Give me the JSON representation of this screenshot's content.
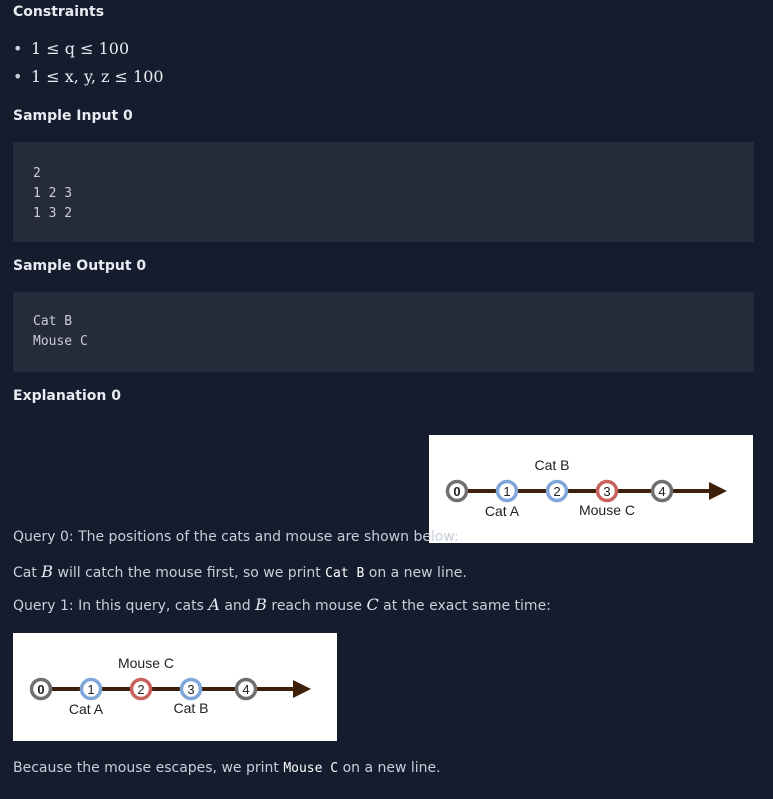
{
  "constraints": {
    "heading": "Constraints",
    "items": [
      "1 ≤ q ≤ 100",
      "1 ≤ x, y, z ≤ 100"
    ]
  },
  "sample_input": {
    "heading": "Sample Input 0",
    "lines": [
      "2",
      "1 2 3",
      "1 3 2"
    ]
  },
  "sample_output": {
    "heading": "Sample Output 0",
    "lines": [
      "Cat B",
      "Mouse C"
    ]
  },
  "explanation": {
    "heading": "Explanation 0",
    "query0": "Query 0: The positions of the cats and mouse are shown below:",
    "line2_pre": "Cat ",
    "line2_var": "B",
    "line2_mid": " will catch the mouse first, so we print ",
    "line2_code": "Cat B",
    "line2_post": " on a new line.",
    "query1_pre": "Query 1: In this query, cats ",
    "query1_a": "A",
    "query1_and": " and ",
    "query1_b": "B",
    "query1_mid": " reach mouse ",
    "query1_c": "C",
    "query1_post": " at the exact same time:",
    "final_pre": "Because the mouse escapes, we print ",
    "final_code": "Mouse C",
    "final_post": " on a new line."
  },
  "figure1": {
    "nodes": [
      "0",
      "1",
      "2",
      "3",
      "4"
    ],
    "label_above": "Cat B",
    "label_below_1": "Cat A",
    "label_below_3": "Mouse C"
  },
  "figure2": {
    "nodes": [
      "0",
      "1",
      "2",
      "3",
      "4"
    ],
    "label_above": "Mouse C",
    "label_below_1": "Cat A",
    "label_below_3": "Cat B"
  },
  "colors": {
    "background": "#151c2e",
    "code_block": "#252b3a",
    "node_gray": "#6f6f6f",
    "node_blue": "#7ea6d8",
    "node_red": "#c9615d",
    "axis_brown": "#3d1f0a"
  }
}
